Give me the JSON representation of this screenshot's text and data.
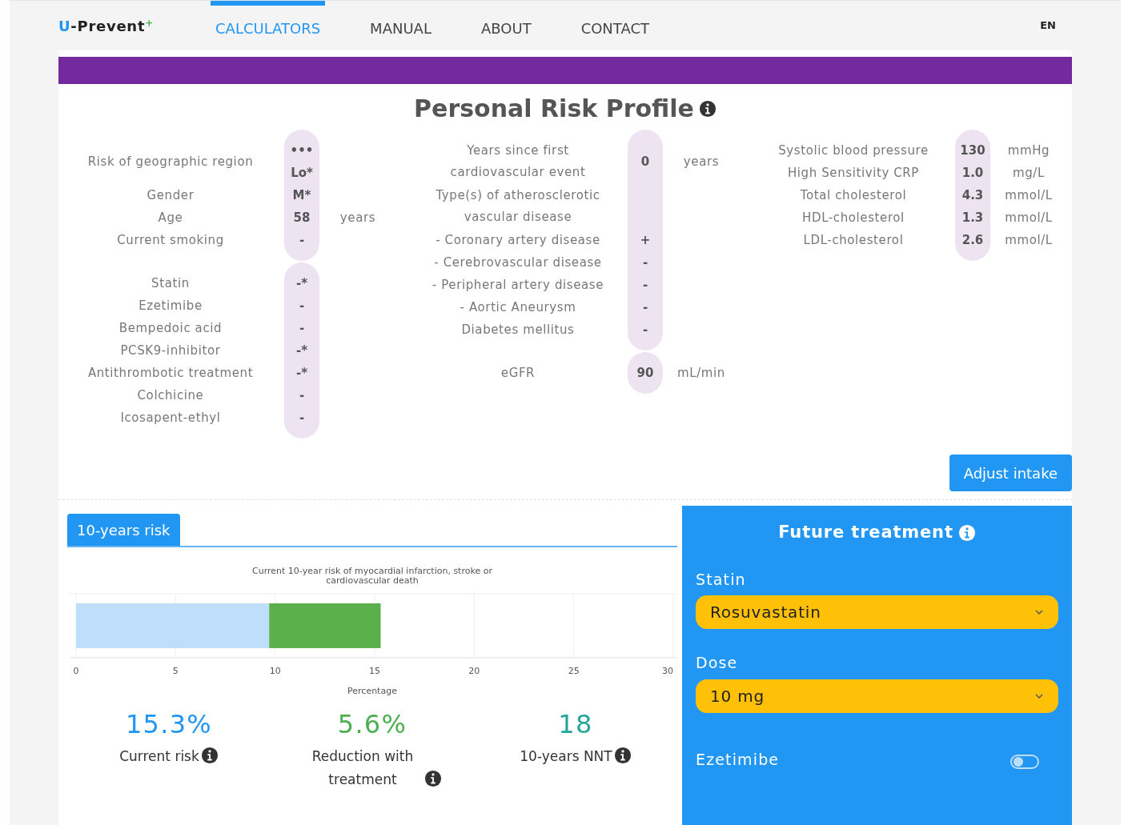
{
  "nav": {
    "logo": "U-Prevent",
    "logo_mark": "+",
    "items": [
      {
        "label": "CALCULATORS",
        "selected": true
      },
      {
        "label": "MANUAL",
        "selected": false
      },
      {
        "label": "ABOUT",
        "selected": false
      },
      {
        "label": "CONTACT",
        "selected": false
      }
    ],
    "language": "EN"
  },
  "profile": {
    "title": "Personal Risk Profile",
    "columns": [
      {
        "groups": [
          {
            "rows": [
              {
                "label": "Risk of geographic region",
                "values": [
                  "•••",
                  "Lo*"
                ]
              },
              {
                "label": "Gender",
                "values": [
                  "M*"
                ]
              },
              {
                "label": "Age",
                "values": [
                  "58"
                ],
                "unit": "years"
              },
              {
                "label": "Current smoking",
                "values": [
                  "-"
                ]
              }
            ]
          },
          {
            "rows": [
              {
                "label": "Statin",
                "values": [
                  "-*"
                ]
              },
              {
                "label": "Ezetimibe",
                "values": [
                  "-"
                ]
              },
              {
                "label": "Bempedoic acid",
                "values": [
                  "-"
                ]
              },
              {
                "label": "PCSK9-inhibitor",
                "values": [
                  "-*"
                ]
              },
              {
                "label": "Antithrombotic treatment",
                "values": [
                  "-*"
                ]
              },
              {
                "label": "Colchicine",
                "values": [
                  "-"
                ]
              },
              {
                "label": "Icosapent-ethyl",
                "values": [
                  "-"
                ]
              }
            ]
          }
        ]
      },
      {
        "groups": [
          {
            "rows": [
              {
                "label": "Years since first cardiovascular event",
                "values": [
                  "0"
                ],
                "unit": "years"
              },
              {
                "label": "Type(s) of atherosclerotic vascular disease"
              },
              {
                "label": "- Coronary artery disease",
                "values": [
                  "+"
                ]
              },
              {
                "label": "- Cerebrovascular disease",
                "values": [
                  "-"
                ]
              },
              {
                "label": "- Peripheral artery disease",
                "values": [
                  "-"
                ]
              },
              {
                "label": "- Aortic Aneurysm",
                "values": [
                  "-"
                ]
              },
              {
                "label": "Diabetes mellitus",
                "values": [
                  "-"
                ]
              }
            ]
          },
          {
            "rows": [
              {
                "label": "eGFR",
                "values": [
                  "90"
                ],
                "unit": "mL/min"
              }
            ]
          }
        ]
      },
      {
        "groups": [
          {
            "rows": [
              {
                "label": "Systolic blood pressure",
                "values": [
                  "130"
                ],
                "unit": "mmHg"
              },
              {
                "label": "High Sensitivity CRP",
                "values": [
                  "1.0"
                ],
                "unit": "mg/L"
              },
              {
                "label": "Total cholesterol",
                "values": [
                  "4.3"
                ],
                "unit": "mmol/L"
              },
              {
                "label": "HDL-cholesterol",
                "values": [
                  "1.3"
                ],
                "unit": "mmol/L"
              },
              {
                "label": "LDL-cholesterol",
                "values": [
                  "2.6"
                ],
                "unit": "mmol/L"
              }
            ]
          }
        ]
      }
    ],
    "button": "Adjust intake"
  },
  "results": {
    "tabs": [
      {
        "label": "10-years risk",
        "selected": true
      }
    ],
    "chart_data": {
      "type": "bar",
      "orientation": "horizontal",
      "stacked": true,
      "title": "Current 10-year risk of myocardial infarction, stroke or cardiovascular death",
      "xlabel": "Percentage",
      "categories": [
        null
      ],
      "grid": true,
      "xlim": [
        0,
        30
      ],
      "xticks": [
        0,
        5,
        10,
        15,
        20,
        25,
        30
      ],
      "series": [
        {
          "color": "#bfdef9",
          "values": [
            9.7
          ]
        },
        {
          "color": "#5bb04c",
          "values": [
            5.6
          ]
        }
      ]
    },
    "stats": [
      {
        "value": "15.3%",
        "label": "Current risk",
        "color": "#2196f3"
      },
      {
        "value": "5.6%",
        "label": "Reduction with treatment",
        "color": "#4caf50"
      },
      {
        "value": "18",
        "label": "10-years NNT",
        "color": "#26a69a"
      }
    ]
  },
  "future": {
    "title": "Future treatment",
    "fields": [
      {
        "kind": "select",
        "label": "Statin",
        "value": "Rosuvastatin"
      },
      {
        "kind": "select",
        "label": "Dose",
        "value": "10 mg"
      },
      {
        "kind": "toggle",
        "label": "Ezetimibe",
        "on": false
      }
    ]
  }
}
